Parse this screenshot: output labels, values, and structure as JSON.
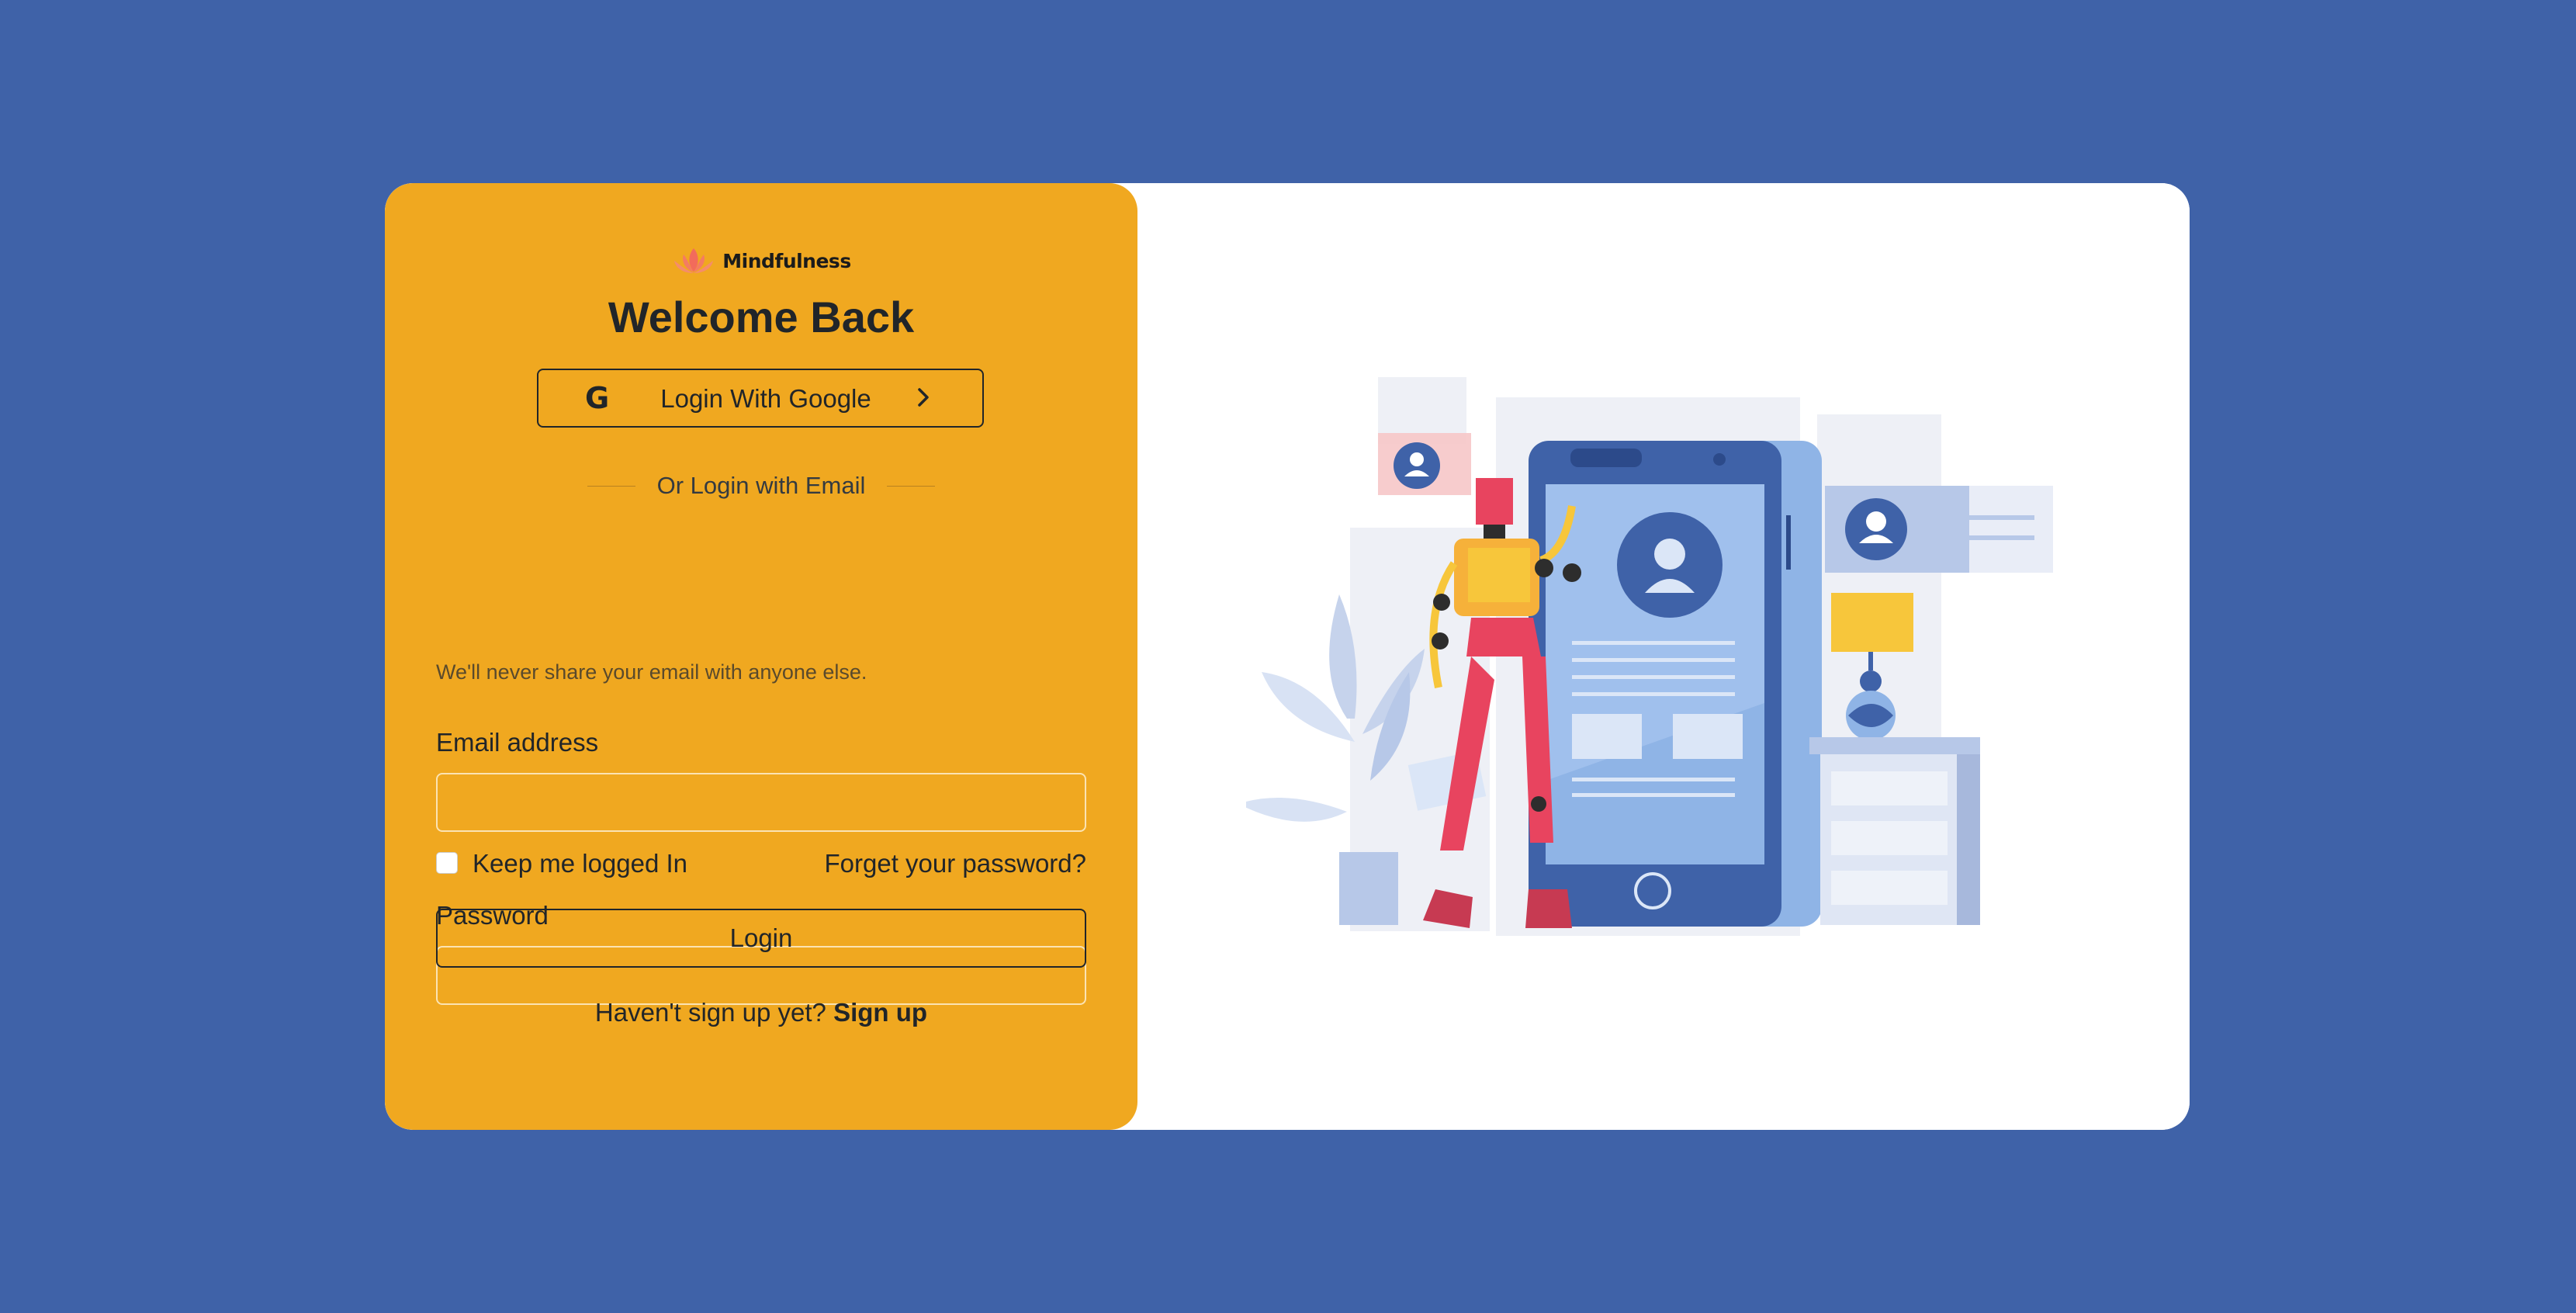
{
  "brand": {
    "name": "Mindfulness",
    "logo_color": "#f26b5b"
  },
  "login": {
    "title": "Welcome Back",
    "google_button_label": "Login With Google",
    "divider_text": "Or Login with Email",
    "email_label": "Email address",
    "email_value": "",
    "email_help": "We'll never share your email with anyone else.",
    "password_label": "Password",
    "password_value": "",
    "remember_label": "Keep me logged In",
    "remember_checked": false,
    "forgot_label": "Forget your password?",
    "login_button_label": "Login",
    "signup_prompt": "Haven't sign up yet?",
    "signup_link": "Sign up"
  },
  "colors": {
    "background": "#3f62a8",
    "panel": "#f0a820",
    "card": "#ffffff",
    "text": "#212529"
  },
  "icons": {
    "logo": "lotus-icon",
    "google": "google-icon",
    "chevron": "chevron-right-icon",
    "illustration": "robot-phone-illustration"
  }
}
